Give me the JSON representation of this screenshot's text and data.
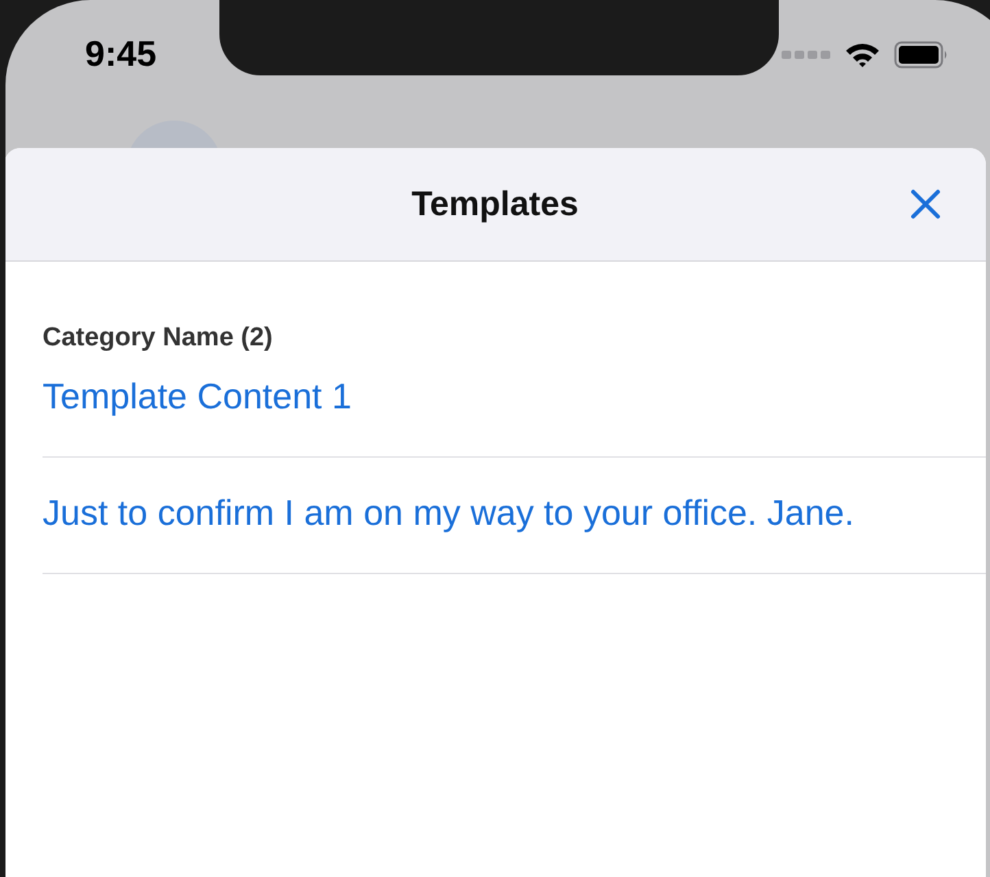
{
  "status_bar": {
    "time": "9:45"
  },
  "sheet": {
    "title": "Templates",
    "sections": [
      {
        "title": "Category Name (2)",
        "items": [
          {
            "text": "Template Content 1"
          },
          {
            "text": "Just to confirm I am on my way to your office. Jane."
          }
        ]
      }
    ]
  }
}
